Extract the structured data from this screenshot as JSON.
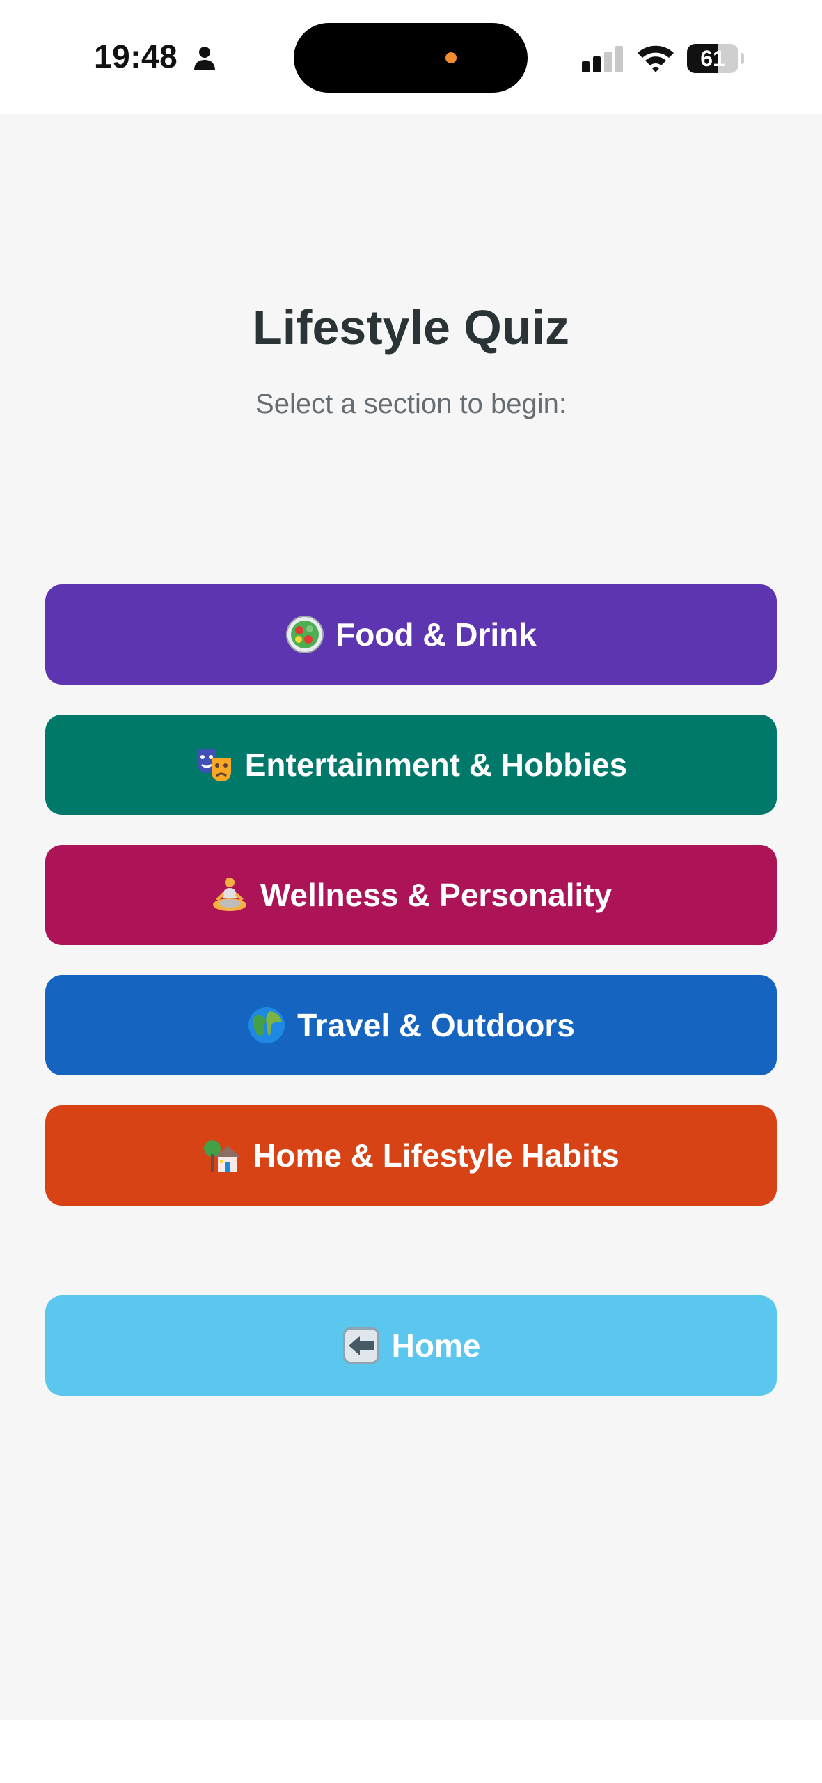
{
  "status_bar": {
    "time": "19:48",
    "battery_level": "61",
    "battery_fraction": 0.61
  },
  "quiz": {
    "title": "Lifestyle Quiz",
    "subtitle": "Select a section to begin:",
    "sections": [
      {
        "label": "Food & Drink",
        "icon": "salad-icon",
        "color": "#5e35b1"
      },
      {
        "label": "Entertainment & Hobbies",
        "icon": "theater-masks-icon",
        "color": "#00796b"
      },
      {
        "label": "Wellness & Personality",
        "icon": "meditation-icon",
        "color": "#ad1457"
      },
      {
        "label": "Travel & Outdoors",
        "icon": "globe-icon",
        "color": "#1565c0"
      },
      {
        "label": "Home & Lifestyle Habits",
        "icon": "house-icon",
        "color": "#d84315"
      }
    ],
    "home_button": {
      "label": "Home",
      "icon": "left-arrow-icon",
      "color": "#5bc6ee"
    }
  }
}
